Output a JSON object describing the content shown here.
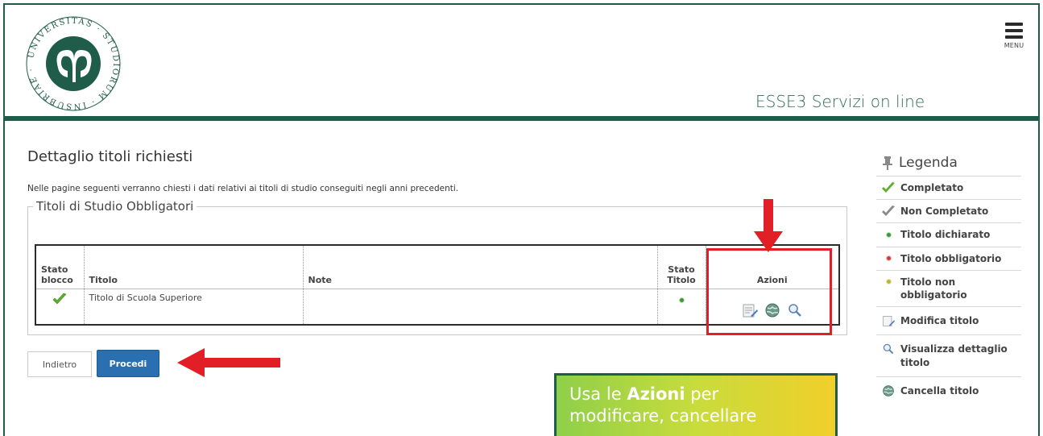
{
  "header": {
    "site_title": "ESSE3 Servizi on line",
    "menu_label": "MENU",
    "logo_text": "UNIVERSITAS STUDIORUM INSUBRIAE"
  },
  "page": {
    "title": "Dettaglio titoli richiesti",
    "intro": "Nelle pagine seguenti verranno chiesti i dati relativi ai titoli di studio conseguiti negli anni precedenti.",
    "fieldset_legend": "Titoli di Studio Obbligatori"
  },
  "table": {
    "headers": {
      "stato_blocco_1": "Stato",
      "stato_blocco_2": "blocco",
      "titolo": "Titolo",
      "note": "Note",
      "stato_titolo_1": "Stato",
      "stato_titolo_2": "Titolo",
      "azioni": "Azioni"
    },
    "rows": [
      {
        "stato_blocco": "check-icon",
        "titolo": "Titolo di Scuola Superiore",
        "note": "",
        "stato_titolo": "green-dot"
      }
    ]
  },
  "buttons": {
    "back": "Indietro",
    "next": "Procedi"
  },
  "tip": {
    "prefix": "Usa le",
    "bold": "Azioni",
    "suffix": "per",
    "line2": "modificare, cancellare"
  },
  "legend": {
    "title": "Legenda",
    "items": [
      {
        "label": "Completato",
        "icon": "green-check-icon"
      },
      {
        "label": "Non Completato",
        "icon": "grey-check-icon"
      },
      {
        "label": "Titolo dichiarato",
        "icon": "green-dot-icon"
      },
      {
        "label": "Titolo obbligatorio",
        "icon": "red-dot-icon"
      },
      {
        "label": "Titolo non obbligatorio",
        "icon": "yellow-dot-icon"
      },
      {
        "label": "Modifica titolo",
        "icon": "edit-icon"
      },
      {
        "label": "Visualizza dettaglio titolo",
        "icon": "magnifier-icon"
      },
      {
        "label": "Cancella titolo",
        "icon": "globe-delete-icon"
      }
    ]
  },
  "colors": {
    "brand_green": "#1f5c4a",
    "primary_button": "#2a6fb0",
    "highlight_red": "#e21f26"
  }
}
